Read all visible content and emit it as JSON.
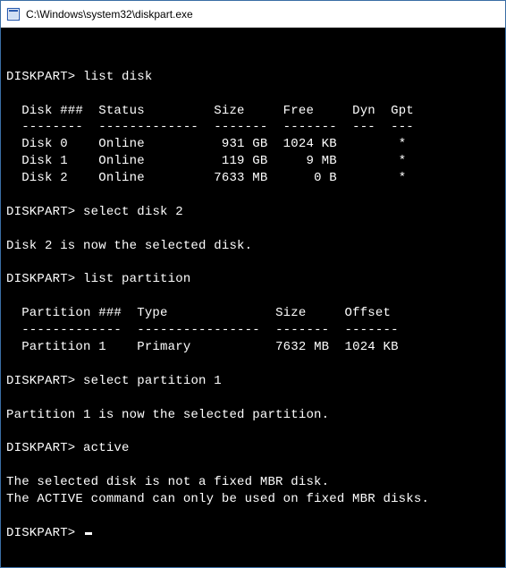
{
  "window": {
    "title": "C:\\Windows\\system32\\diskpart.exe"
  },
  "session": {
    "prompt": "DISKPART>",
    "cmd_list_disk": "list disk",
    "disk_header": {
      "col_disk": "Disk ###",
      "col_status": "Status",
      "col_size": "Size",
      "col_free": "Free",
      "col_dyn": "Dyn",
      "col_gpt": "Gpt"
    },
    "disk_sep": {
      "c1": "--------",
      "c2": "-------------",
      "c3": "-------",
      "c4": "-------",
      "c5": "---",
      "c6": "---"
    },
    "disks": [
      {
        "id": "Disk 0",
        "status": "Online",
        "size": "931 GB",
        "free": "1024 KB",
        "dyn": "",
        "gpt": "*"
      },
      {
        "id": "Disk 1",
        "status": "Online",
        "size": "119 GB",
        "free": "9 MB",
        "dyn": "",
        "gpt": "*"
      },
      {
        "id": "Disk 2",
        "status": "Online",
        "size": "7633 MB",
        "free": "0 B",
        "dyn": "",
        "gpt": "*"
      }
    ],
    "cmd_select_disk": "select disk 2",
    "msg_disk_selected": "Disk 2 is now the selected disk.",
    "cmd_list_partition": "list partition",
    "part_header": {
      "col_part": "Partition ###",
      "col_type": "Type",
      "col_size": "Size",
      "col_offset": "Offset"
    },
    "part_sep": {
      "c1": "-------------",
      "c2": "----------------",
      "c3": "-------",
      "c4": "-------"
    },
    "partitions": [
      {
        "id": "Partition 1",
        "type": "Primary",
        "size": "7632 MB",
        "offset": "1024 KB"
      }
    ],
    "cmd_select_partition": "select partition 1",
    "msg_part_selected": "Partition 1 is now the selected partition.",
    "cmd_active": "active",
    "msg_err1": "The selected disk is not a fixed MBR disk.",
    "msg_err2": "The ACTIVE command can only be used on fixed MBR disks."
  }
}
